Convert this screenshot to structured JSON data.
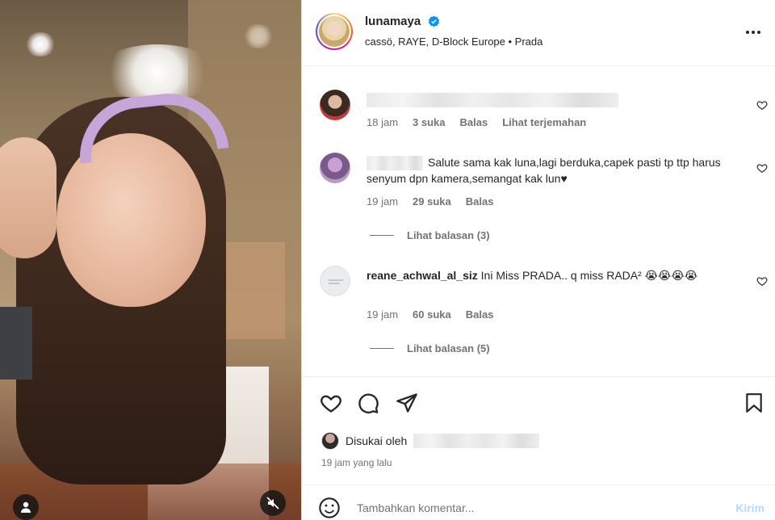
{
  "header": {
    "username": "lunamaya",
    "music": "cassö, RAYE, D-Block Europe • Prada"
  },
  "comments": [
    {
      "text": "",
      "time": "18 jam",
      "likes": "3 suka",
      "reply": "Balas",
      "translate": "Lihat terjemahan"
    },
    {
      "username": "",
      "text": "Salute sama kak luna,lagi berduka,capek pasti tp ttp harus senyum dpn kamera,semangat kak lun♥",
      "time": "19 jam",
      "likes": "29 suka",
      "reply": "Balas",
      "view_replies": "Lihat balasan (3)"
    },
    {
      "username": "reane_achwal_al_siz",
      "text": "Ini Miss PRADA.. q miss RADA² 😭😭😭😭",
      "time": "19 jam",
      "likes": "60 suka",
      "reply": "Balas",
      "view_replies": "Lihat balasan (5)"
    }
  ],
  "likes": {
    "label": "Disukai oleh"
  },
  "time_ago": "19 jam yang lalu",
  "add_comment": {
    "placeholder": "Tambahkan komentar...",
    "post_label": "Kirim"
  },
  "colors": {
    "verified": "#0095f6",
    "post_button_disabled": "#b3dbff",
    "meta_text": "#737373"
  }
}
